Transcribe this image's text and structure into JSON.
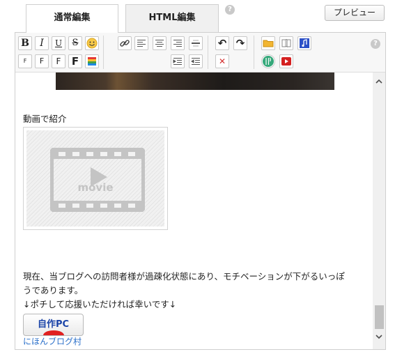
{
  "tabs": [
    {
      "label": "通常編集"
    },
    {
      "label": "HTML編集"
    }
  ],
  "help_glyph": "?",
  "preview_label": "プレビュー",
  "toolbar": {
    "bold": "B",
    "italic": "I",
    "underline": "U",
    "strike": "S",
    "emoji": "☺",
    "font_sizes": [
      "F",
      "F",
      "F",
      "F"
    ],
    "undo": "↶",
    "redo": "↷",
    "delete": "✕"
  },
  "content": {
    "video_heading": "動画で紹介",
    "movie_label": "movie",
    "paragraph_line1": "現在、当ブログへの訪問者様が過疎化状態にあり、モチベーションが下がるいっぽ",
    "paragraph_line2": "うであります。",
    "paragraph_line3": "↓ポチして応援いただければ幸いです↓",
    "banner_text": "自作PC",
    "link_text": "にほんブログ村"
  },
  "scrollbar": {
    "up": "∧",
    "down": "∨"
  },
  "colors": {
    "link": "#2a6fc9",
    "banner_text": "#1a44a8",
    "banner_red": "#e02020",
    "movie_icon": "#c4c4c4"
  }
}
